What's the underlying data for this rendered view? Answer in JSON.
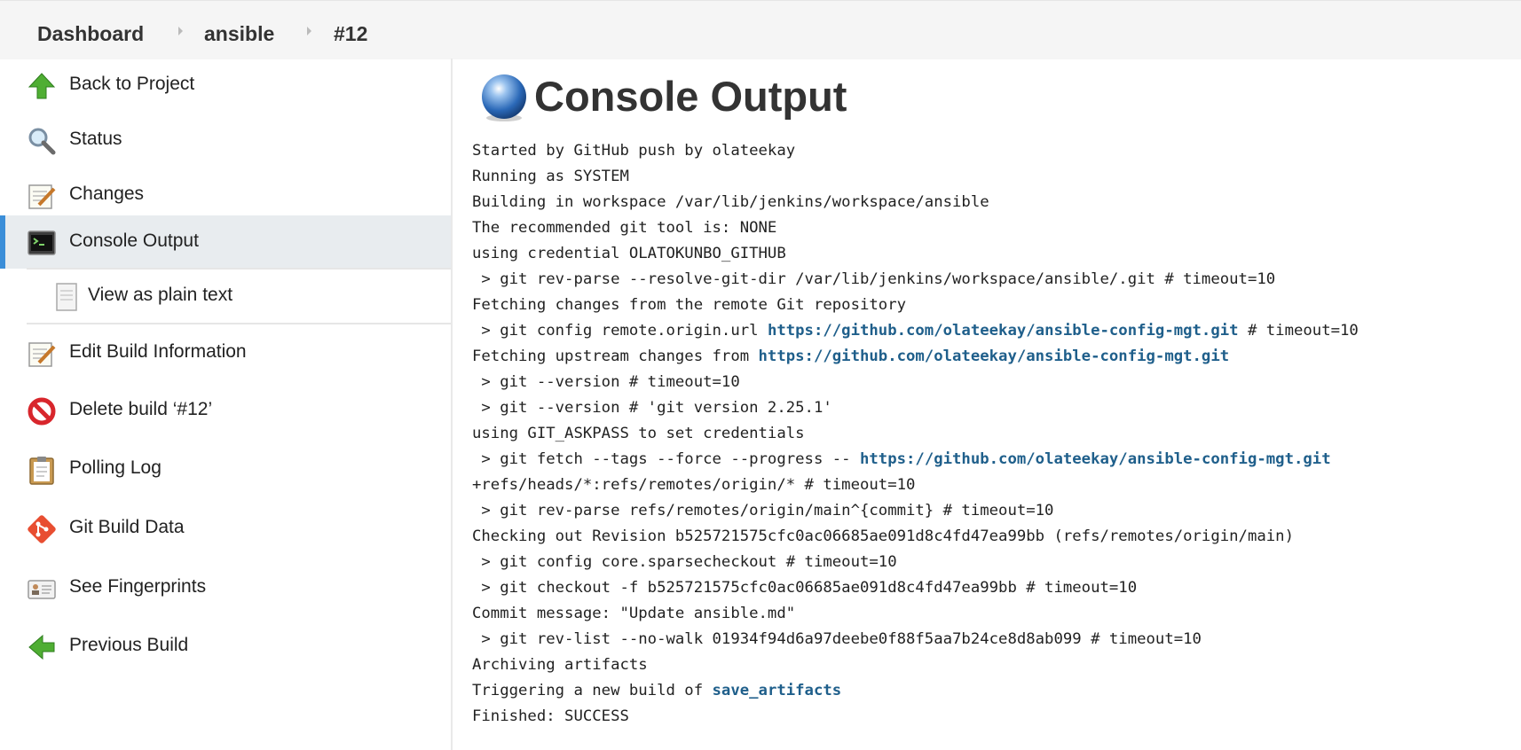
{
  "breadcrumb": {
    "items": [
      {
        "label": "Dashboard"
      },
      {
        "label": "ansible"
      },
      {
        "label": "#12"
      }
    ]
  },
  "sidebar": {
    "items": [
      {
        "label": "Back to Project",
        "icon": "up-arrow-icon"
      },
      {
        "label": "Status",
        "icon": "magnifier-icon"
      },
      {
        "label": "Changes",
        "icon": "notepad-icon"
      },
      {
        "label": "Console Output",
        "icon": "terminal-icon",
        "active": true
      },
      {
        "label": "View as plain text",
        "icon": "document-icon"
      },
      {
        "label": "Edit Build Information",
        "icon": "notepad-icon"
      },
      {
        "label": "Delete build ‘#12’",
        "icon": "no-entry-icon"
      },
      {
        "label": "Polling Log",
        "icon": "clipboard-icon"
      },
      {
        "label": "Git Build Data",
        "icon": "git-icon"
      },
      {
        "label": "See Fingerprints",
        "icon": "id-card-icon"
      },
      {
        "label": "Previous Build",
        "icon": "left-arrow-icon"
      }
    ]
  },
  "main": {
    "title": "Console Output",
    "title_icon": "blue-ball-icon",
    "console_lines": [
      {
        "segments": [
          {
            "text": "Started by GitHub push by olateekay"
          }
        ]
      },
      {
        "segments": [
          {
            "text": "Running as SYSTEM"
          }
        ]
      },
      {
        "segments": [
          {
            "text": "Building in workspace /var/lib/jenkins/workspace/ansible"
          }
        ]
      },
      {
        "segments": [
          {
            "text": "The recommended git tool is: NONE"
          }
        ]
      },
      {
        "segments": [
          {
            "text": "using credential OLATOKUNBO_GITHUB"
          }
        ]
      },
      {
        "segments": [
          {
            "text": " > git rev-parse --resolve-git-dir /var/lib/jenkins/workspace/ansible/.git # timeout=10"
          }
        ]
      },
      {
        "segments": [
          {
            "text": "Fetching changes from the remote Git repository"
          }
        ]
      },
      {
        "segments": [
          {
            "text": " > git config remote.origin.url "
          },
          {
            "text": "https://github.com/olateekay/ansible-config-mgt.git",
            "link": true
          },
          {
            "text": " # timeout=10"
          }
        ]
      },
      {
        "segments": [
          {
            "text": "Fetching upstream changes from "
          },
          {
            "text": "https://github.com/olateekay/ansible-config-mgt.git",
            "link": true
          }
        ]
      },
      {
        "segments": [
          {
            "text": " > git --version # timeout=10"
          }
        ]
      },
      {
        "segments": [
          {
            "text": " > git --version # 'git version 2.25.1'"
          }
        ]
      },
      {
        "segments": [
          {
            "text": "using GIT_ASKPASS to set credentials"
          }
        ]
      },
      {
        "segments": [
          {
            "text": " > git fetch --tags --force --progress -- "
          },
          {
            "text": "https://github.com/olateekay/ansible-config-mgt.git",
            "link": true
          }
        ]
      },
      {
        "segments": [
          {
            "text": "+refs/heads/*:refs/remotes/origin/* # timeout=10"
          }
        ]
      },
      {
        "segments": [
          {
            "text": " > git rev-parse refs/remotes/origin/main^{commit} # timeout=10"
          }
        ]
      },
      {
        "segments": [
          {
            "text": "Checking out Revision b525721575cfc0ac06685ae091d8c4fd47ea99bb (refs/remotes/origin/main)"
          }
        ]
      },
      {
        "segments": [
          {
            "text": " > git config core.sparsecheckout # timeout=10"
          }
        ]
      },
      {
        "segments": [
          {
            "text": " > git checkout -f b525721575cfc0ac06685ae091d8c4fd47ea99bb # timeout=10"
          }
        ]
      },
      {
        "segments": [
          {
            "text": "Commit message: \"Update ansible.md\""
          }
        ]
      },
      {
        "segments": [
          {
            "text": " > git rev-list --no-walk 01934f94d6a97deebe0f88f5aa7b24ce8d8ab099 # timeout=10"
          }
        ]
      },
      {
        "segments": [
          {
            "text": "Archiving artifacts"
          }
        ]
      },
      {
        "segments": [
          {
            "text": "Triggering a new build of "
          },
          {
            "text": "save_artifacts",
            "link": true
          }
        ]
      },
      {
        "segments": [
          {
            "text": "Finished: SUCCESS"
          }
        ]
      }
    ]
  },
  "colors": {
    "link": "#1f5f8b",
    "active_accent": "#3b8ed8",
    "active_bg": "#e8ecef",
    "topbar_bg": "#f5f5f5"
  }
}
